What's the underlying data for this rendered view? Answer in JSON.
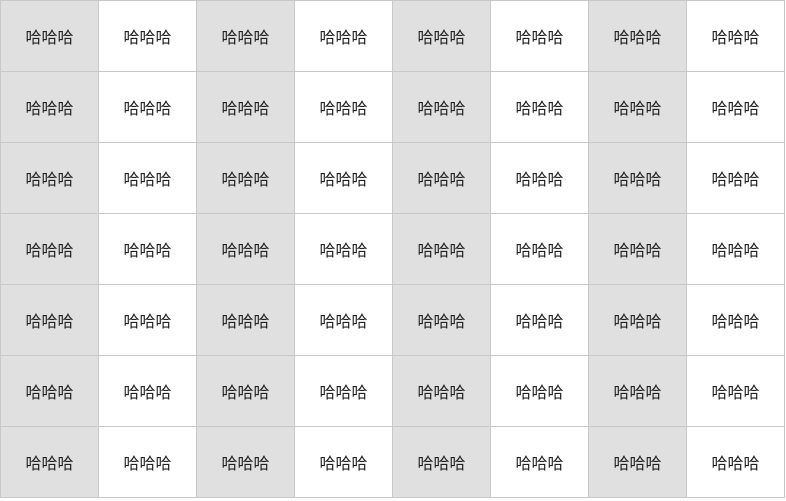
{
  "grid": {
    "shaded_color": "#e0e0e0",
    "plain_color": "#ffffff",
    "border_color": "#c8c8c8",
    "rows": [
      [
        "哈哈哈",
        "哈哈哈",
        "哈哈哈",
        "哈哈哈",
        "哈哈哈",
        "哈哈哈",
        "哈哈哈",
        "哈哈哈"
      ],
      [
        "哈哈哈",
        "哈哈哈",
        "哈哈哈",
        "哈哈哈",
        "哈哈哈",
        "哈哈哈",
        "哈哈哈",
        "哈哈哈"
      ],
      [
        "哈哈哈",
        "哈哈哈",
        "哈哈哈",
        "哈哈哈",
        "哈哈哈",
        "哈哈哈",
        "哈哈哈",
        "哈哈哈"
      ],
      [
        "哈哈哈",
        "哈哈哈",
        "哈哈哈",
        "哈哈哈",
        "哈哈哈",
        "哈哈哈",
        "哈哈哈",
        "哈哈哈"
      ],
      [
        "哈哈哈",
        "哈哈哈",
        "哈哈哈",
        "哈哈哈",
        "哈哈哈",
        "哈哈哈",
        "哈哈哈",
        "哈哈哈"
      ],
      [
        "哈哈哈",
        "哈哈哈",
        "哈哈哈",
        "哈哈哈",
        "哈哈哈",
        "哈哈哈",
        "哈哈哈",
        "哈哈哈"
      ],
      [
        "哈哈哈",
        "哈哈哈",
        "哈哈哈",
        "哈哈哈",
        "哈哈哈",
        "哈哈哈",
        "哈哈哈",
        "哈哈哈"
      ]
    ]
  }
}
